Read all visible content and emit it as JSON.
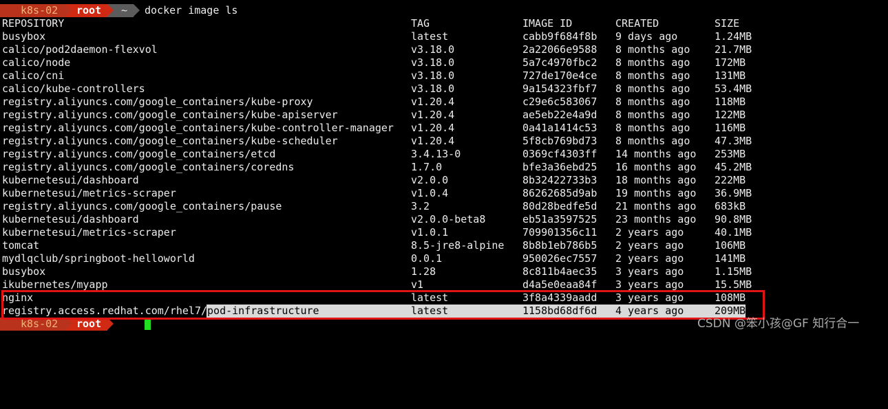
{
  "terminal": {
    "prompt": {
      "host": "k8s-02",
      "user": "root",
      "cwd": "~",
      "command": "docker image ls"
    },
    "table": {
      "headers": [
        "REPOSITORY",
        "TAG",
        "IMAGE ID",
        "CREATED",
        "SIZE"
      ],
      "rows": [
        {
          "repository": "busybox",
          "tag": "latest",
          "image_id": "cabb9f684f8b",
          "created": "9 days ago",
          "size": "1.24MB"
        },
        {
          "repository": "calico/pod2daemon-flexvol",
          "tag": "v3.18.0",
          "image_id": "2a22066e9588",
          "created": "8 months ago",
          "size": "21.7MB"
        },
        {
          "repository": "calico/node",
          "tag": "v3.18.0",
          "image_id": "5a7c4970fbc2",
          "created": "8 months ago",
          "size": "172MB"
        },
        {
          "repository": "calico/cni",
          "tag": "v3.18.0",
          "image_id": "727de170e4ce",
          "created": "8 months ago",
          "size": "131MB"
        },
        {
          "repository": "calico/kube-controllers",
          "tag": "v3.18.0",
          "image_id": "9a154323fbf7",
          "created": "8 months ago",
          "size": "53.4MB"
        },
        {
          "repository": "registry.aliyuncs.com/google_containers/kube-proxy",
          "tag": "v1.20.4",
          "image_id": "c29e6c583067",
          "created": "8 months ago",
          "size": "118MB"
        },
        {
          "repository": "registry.aliyuncs.com/google_containers/kube-apiserver",
          "tag": "v1.20.4",
          "image_id": "ae5eb22e4a9d",
          "created": "8 months ago",
          "size": "122MB"
        },
        {
          "repository": "registry.aliyuncs.com/google_containers/kube-controller-manager",
          "tag": "v1.20.4",
          "image_id": "0a41a1414c53",
          "created": "8 months ago",
          "size": "116MB"
        },
        {
          "repository": "registry.aliyuncs.com/google_containers/kube-scheduler",
          "tag": "v1.20.4",
          "image_id": "5f8cb769bd73",
          "created": "8 months ago",
          "size": "47.3MB"
        },
        {
          "repository": "registry.aliyuncs.com/google_containers/etcd",
          "tag": "3.4.13-0",
          "image_id": "0369cf4303ff",
          "created": "14 months ago",
          "size": "253MB"
        },
        {
          "repository": "registry.aliyuncs.com/google_containers/coredns",
          "tag": "1.7.0",
          "image_id": "bfe3a36ebd25",
          "created": "16 months ago",
          "size": "45.2MB"
        },
        {
          "repository": "kubernetesui/dashboard",
          "tag": "v2.0.0",
          "image_id": "8b32422733b3",
          "created": "18 months ago",
          "size": "222MB"
        },
        {
          "repository": "kubernetesui/metrics-scraper",
          "tag": "v1.0.4",
          "image_id": "86262685d9ab",
          "created": "19 months ago",
          "size": "36.9MB"
        },
        {
          "repository": "registry.aliyuncs.com/google_containers/pause",
          "tag": "3.2",
          "image_id": "80d28bedfe5d",
          "created": "21 months ago",
          "size": "683kB"
        },
        {
          "repository": "kubernetesui/dashboard",
          "tag": "v2.0.0-beta8",
          "image_id": "eb51a3597525",
          "created": "23 months ago",
          "size": "90.8MB"
        },
        {
          "repository": "kubernetesui/metrics-scraper",
          "tag": "v1.0.1",
          "image_id": "709901356c11",
          "created": "2 years ago",
          "size": "40.1MB"
        },
        {
          "repository": "tomcat",
          "tag": "8.5-jre8-alpine",
          "image_id": "8b8b1eb786b5",
          "created": "2 years ago",
          "size": "106MB"
        },
        {
          "repository": "mydlqclub/springboot-helloworld",
          "tag": "0.0.1",
          "image_id": "950026ec7557",
          "created": "2 years ago",
          "size": "141MB"
        },
        {
          "repository": "busybox",
          "tag": "1.28",
          "image_id": "8c811b4aec35",
          "created": "3 years ago",
          "size": "1.15MB"
        },
        {
          "repository": "ikubernetes/myapp",
          "tag": "v1",
          "image_id": "d4a5e0eaa84f",
          "created": "3 years ago",
          "size": "15.5MB"
        },
        {
          "repository": "nginx",
          "tag": "latest",
          "image_id": "3f8a4339aadd",
          "created": "3 years ago",
          "size": "108MB"
        },
        {
          "repository": "registry.access.redhat.com/rhel7/pod-infrastructure",
          "tag": "latest",
          "image_id": "1158bd68df6d",
          "created": "4 years ago",
          "size": "209MB",
          "selected": true
        }
      ]
    },
    "next_prompt": {
      "host": "k8s-02",
      "user": "root"
    }
  },
  "colors": {
    "background": "#000000",
    "text": "#ececec",
    "host_segment": "#b8321c",
    "user_segment": "#d02a14",
    "cwd_segment": "#5c5c5c",
    "selection": "#dadada",
    "highlight_box": "#e01414",
    "cursor": "#22dd22"
  },
  "watermark": "CSDN @笨小孩@GF 知行合一"
}
